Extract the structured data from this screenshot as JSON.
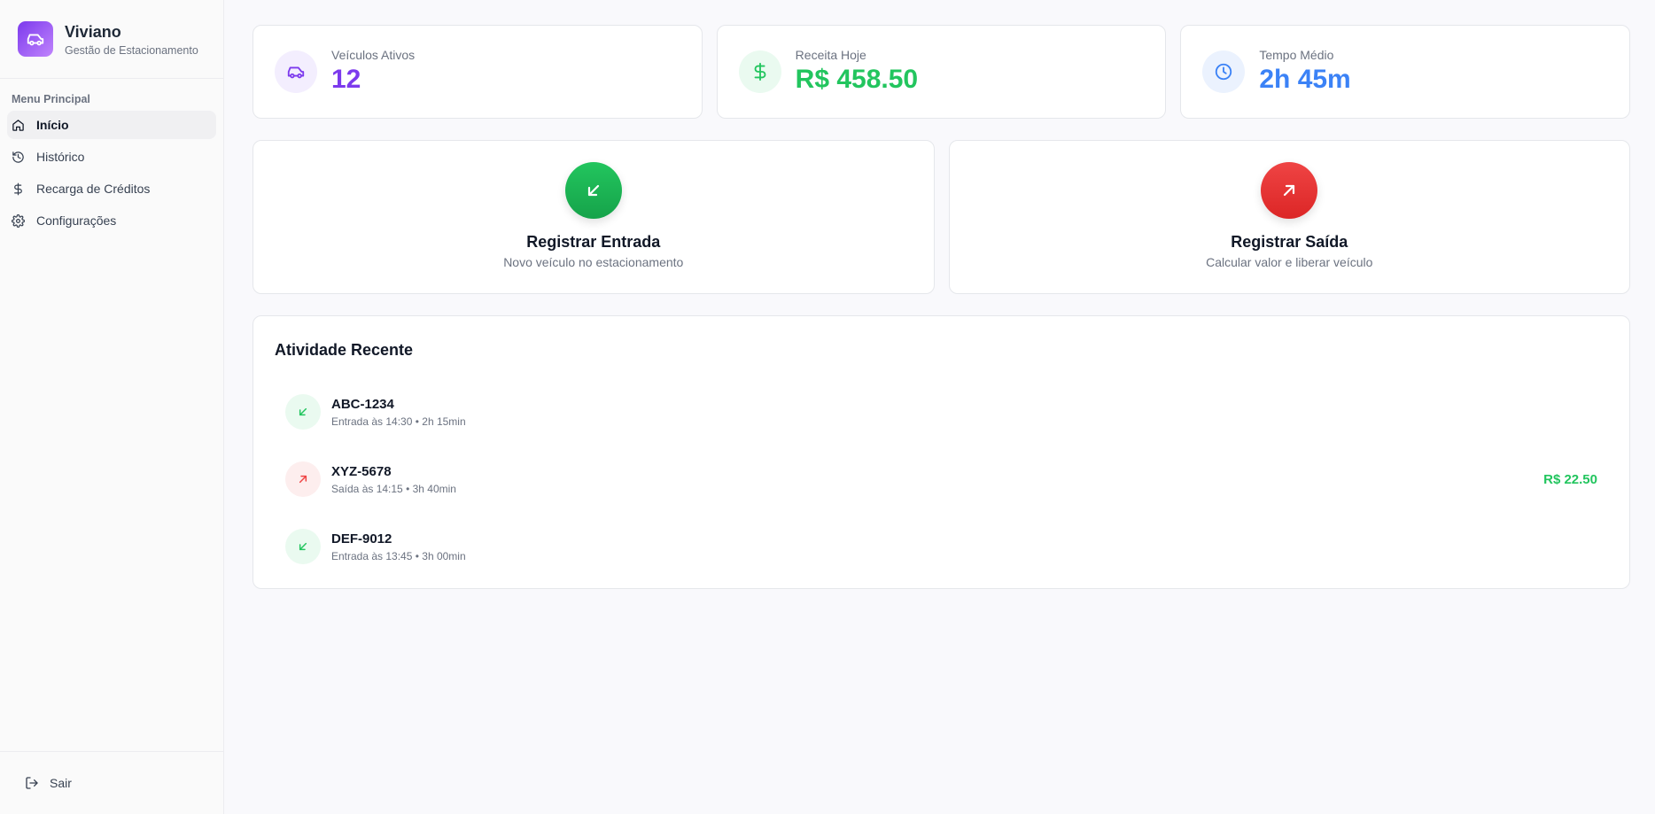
{
  "brand": {
    "title": "Viviano",
    "subtitle": "Gestão de Estacionamento"
  },
  "nav": {
    "section_label": "Menu Principal",
    "items": [
      {
        "label": "Início",
        "icon": "home-icon",
        "active": true
      },
      {
        "label": "Histórico",
        "icon": "history-icon",
        "active": false
      },
      {
        "label": "Recarga de Créditos",
        "icon": "dollar-icon",
        "active": false
      },
      {
        "label": "Configurações",
        "icon": "gear-icon",
        "active": false
      }
    ],
    "logout_label": "Sair"
  },
  "stats": [
    {
      "label": "Veículos Ativos",
      "value": "12",
      "icon": "car-icon",
      "color": "#7c3aed",
      "bg": "#f3eefe"
    },
    {
      "label": "Receita Hoje",
      "value": "R$ 458.50",
      "icon": "dollar-icon",
      "color": "#22c55e",
      "bg": "#eafaf0"
    },
    {
      "label": "Tempo Médio",
      "value": "2h 45m",
      "icon": "clock-icon",
      "color": "#3b82f6",
      "bg": "#ebf2fe"
    }
  ],
  "actions": [
    {
      "title": "Registrar Entrada",
      "subtitle": "Novo veículo no estacionamento",
      "icon": "arrow-down-left-icon",
      "color": "#16a34a"
    },
    {
      "title": "Registrar Saída",
      "subtitle": "Calcular valor e liberar veículo",
      "icon": "arrow-up-right-icon",
      "color": "#dc2626"
    }
  ],
  "activity": {
    "title": "Atividade Recente",
    "items": [
      {
        "plate": "ABC-1234",
        "detail": "Entrada às 14:30 • 2h 15min",
        "type": "entrada",
        "amount": ""
      },
      {
        "plate": "XYZ-5678",
        "detail": "Saída às 14:15 • 3h 40min",
        "type": "saida",
        "amount": "R$ 22.50"
      },
      {
        "plate": "DEF-9012",
        "detail": "Entrada às 13:45 • 3h 00min",
        "type": "entrada",
        "amount": ""
      }
    ]
  }
}
